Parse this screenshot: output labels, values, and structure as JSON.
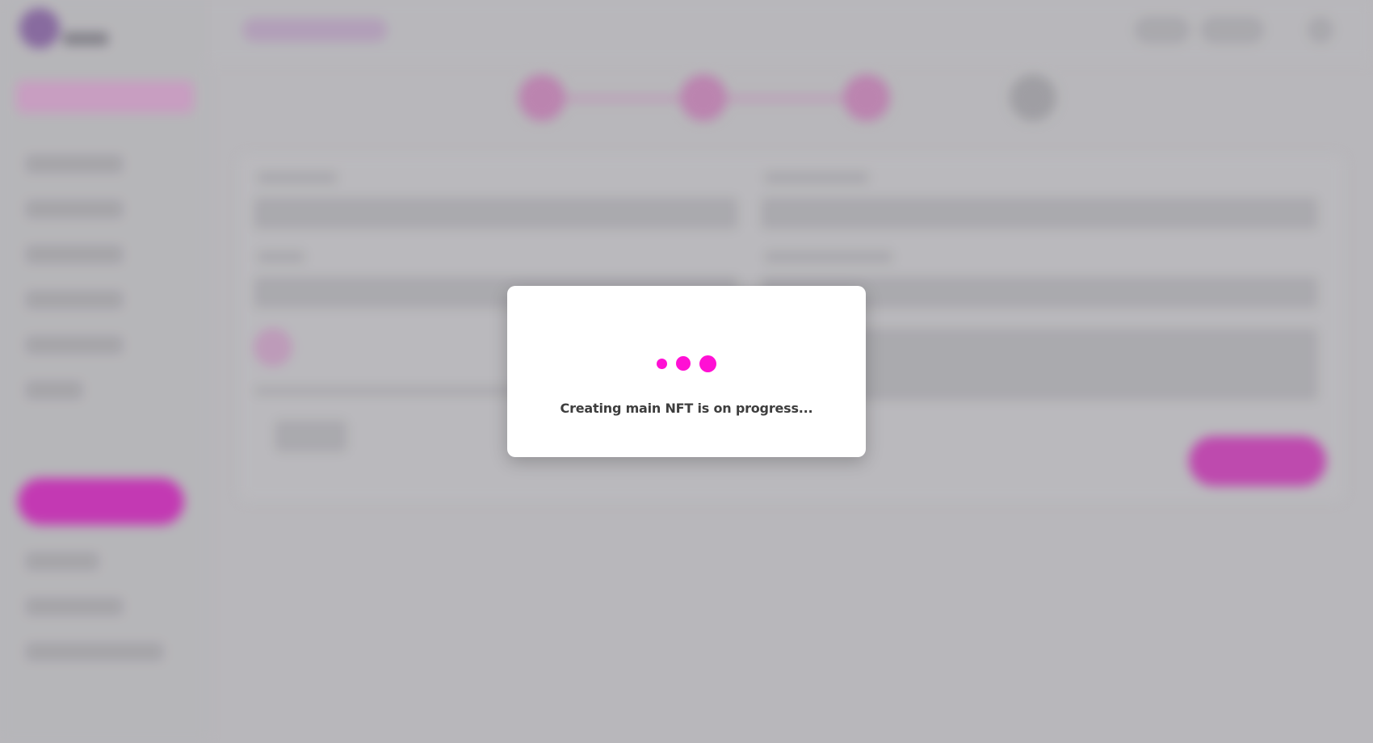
{
  "modal": {
    "loader_icon": "three-dot-loader-icon",
    "accent_color": "#ff10d4",
    "message": "Creating main NFT is on progress..."
  }
}
